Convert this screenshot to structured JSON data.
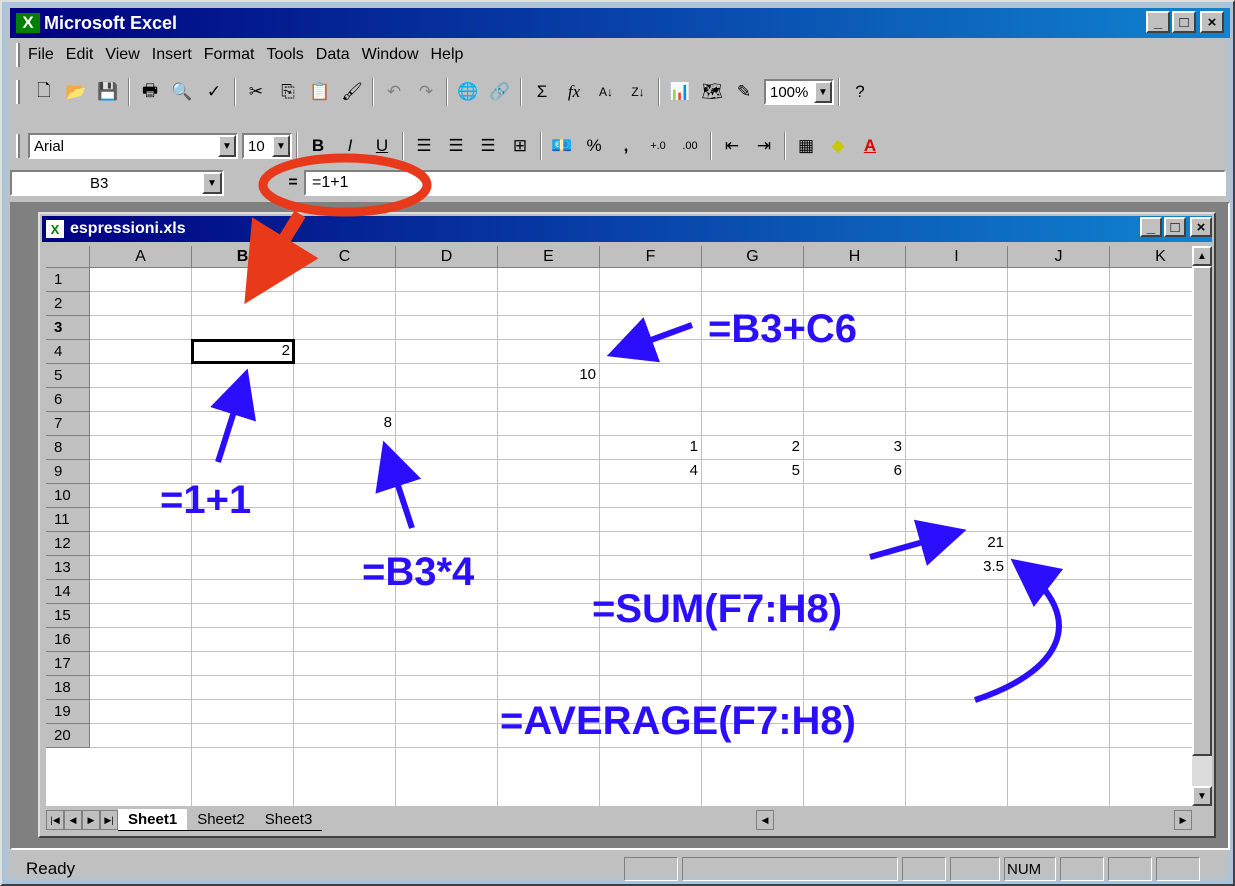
{
  "app": {
    "title": "Microsoft Excel",
    "icon": "excel-icon"
  },
  "menu": [
    "File",
    "Edit",
    "View",
    "Insert",
    "Format",
    "Tools",
    "Data",
    "Window",
    "Help"
  ],
  "toolbar": {
    "zoom": "100%"
  },
  "format": {
    "font": "Arial",
    "size": "10"
  },
  "formula_bar": {
    "cell_ref": "B3",
    "equals": "=",
    "formula": "=1+1"
  },
  "workbook": {
    "title": "espressioni.xls"
  },
  "columns": [
    "A",
    "B",
    "C",
    "D",
    "E",
    "F",
    "G",
    "H",
    "I",
    "J",
    "K"
  ],
  "rows": [
    "1",
    "2",
    "3",
    "4",
    "5",
    "6",
    "7",
    "8",
    "9",
    "10",
    "11",
    "12",
    "13",
    "14",
    "15",
    "16",
    "17",
    "18",
    "19",
    "20"
  ],
  "cells": {
    "b3": "2",
    "e4": "10",
    "c6": "8",
    "f7": "1",
    "g7": "2",
    "h7": "3",
    "f8": "4",
    "g8": "5",
    "h8": "6",
    "i10": "21",
    "i11": "3.5"
  },
  "sheet_tabs": [
    "Sheet1",
    "Sheet2",
    "Sheet3"
  ],
  "status": {
    "ready": "Ready",
    "num": "NUM"
  },
  "annotations": {
    "a1": "=1+1",
    "a2": "=B3+C6",
    "a3": "=B3*4",
    "a4": "=SUM(F7:H8)",
    "a5": "=AVERAGE(F7:H8)"
  },
  "colors": {
    "title_bar": "#000080",
    "annotation": "#2c0eff",
    "highlight": "#e83a1a"
  }
}
